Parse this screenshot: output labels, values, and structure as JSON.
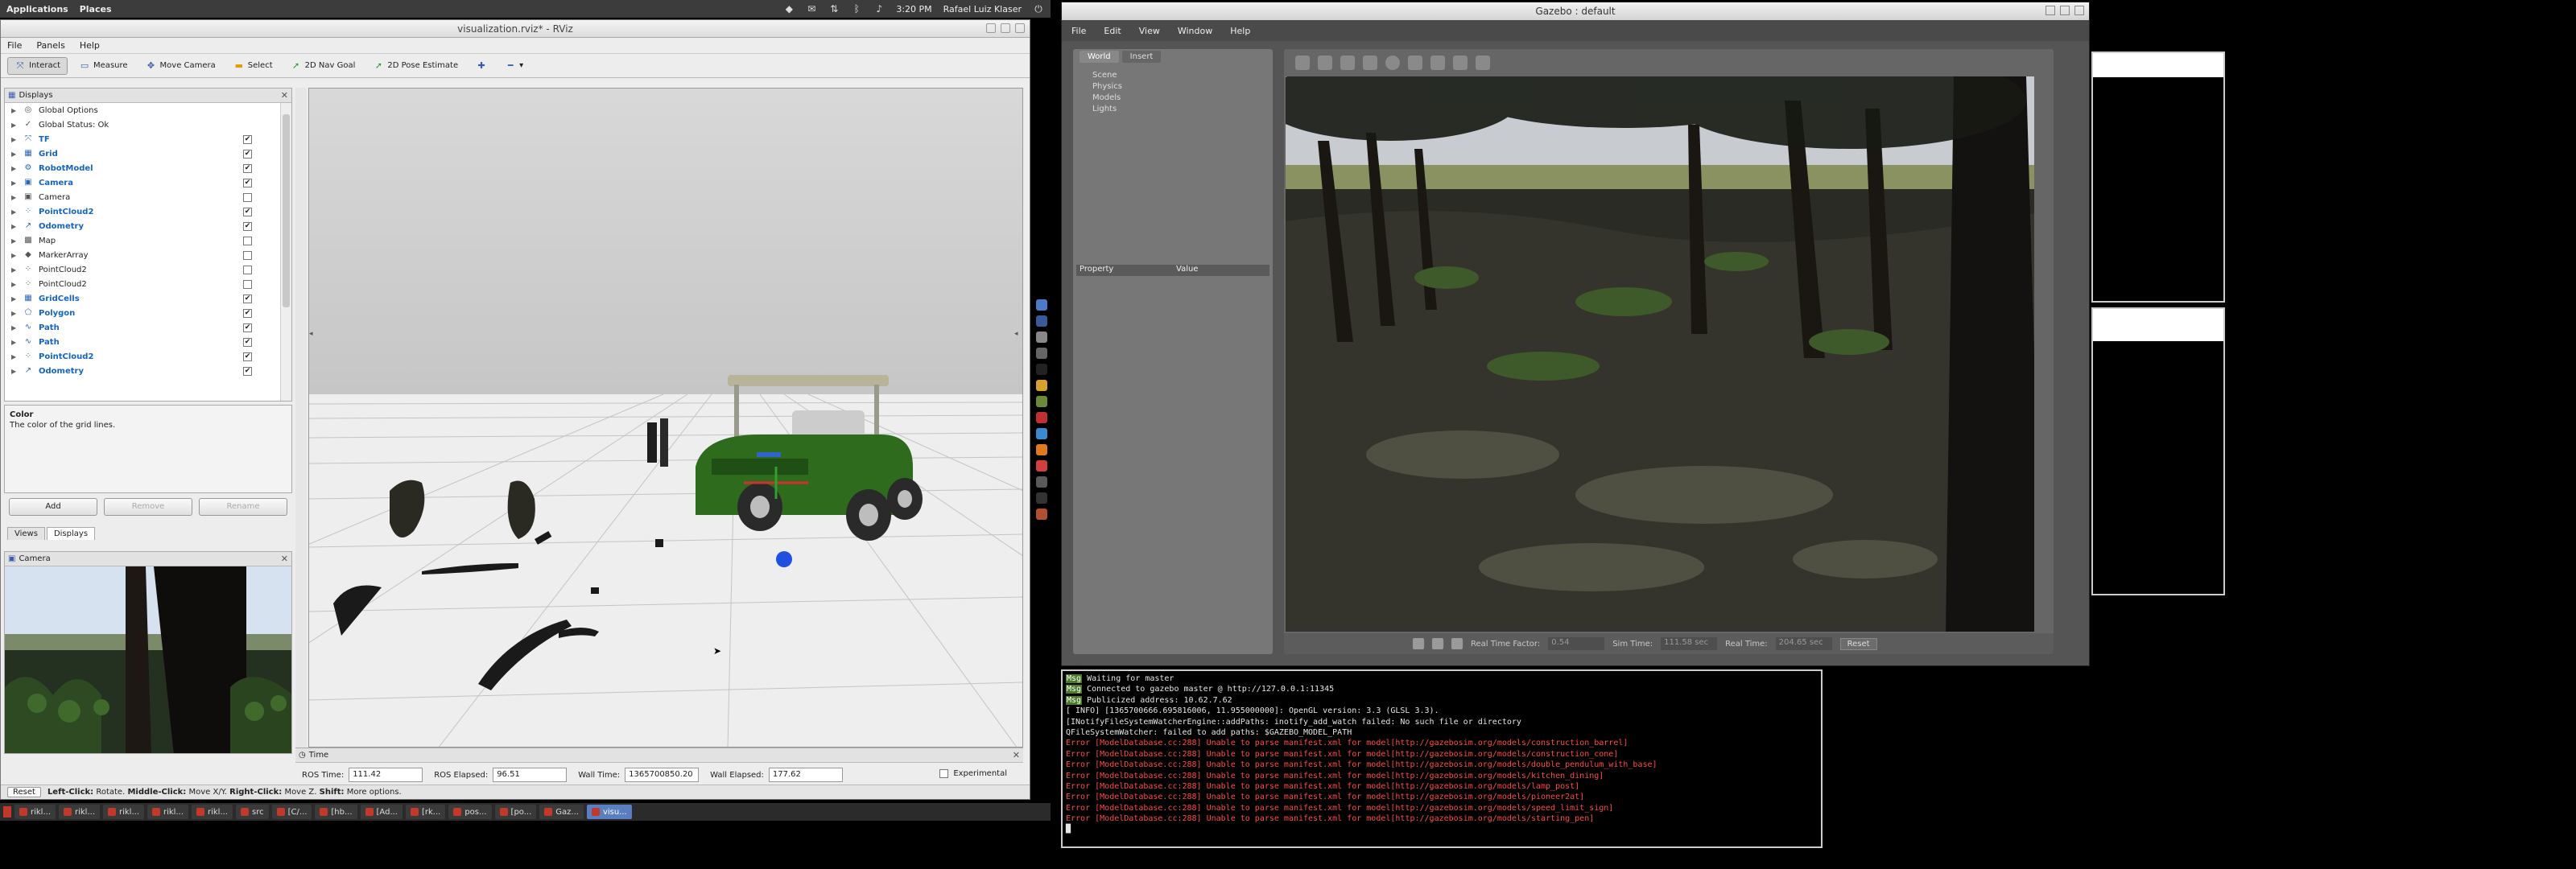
{
  "top_panel": {
    "menu_applications": "Applications",
    "menu_places": "Places",
    "clock": "3:20 PM",
    "user": "Rafael Luiz Klaser"
  },
  "rviz": {
    "title": "visualization.rviz* - RViz",
    "menu": [
      "File",
      "Panels",
      "Help"
    ],
    "toolbar": {
      "interact": "Interact",
      "measure": "Measure",
      "move_camera": "Move Camera",
      "select": "Select",
      "nav_goal": "2D Nav Goal",
      "pose_estimate": "2D Pose Estimate"
    },
    "displays_title": "Displays",
    "displays": [
      {
        "label": "Global Options",
        "blue": false,
        "icon": "globe-icon",
        "checked": null
      },
      {
        "label": "Global Status: Ok",
        "blue": false,
        "icon": "check-icon",
        "checked": null
      },
      {
        "label": "TF",
        "blue": true,
        "icon": "tf-icon",
        "checked": true
      },
      {
        "label": "Grid",
        "blue": true,
        "icon": "grid-icon",
        "checked": true
      },
      {
        "label": "RobotModel",
        "blue": true,
        "icon": "robot-icon",
        "checked": true
      },
      {
        "label": "Camera",
        "blue": true,
        "icon": "camera-icon",
        "checked": true
      },
      {
        "label": "Camera",
        "blue": false,
        "icon": "camera-icon",
        "checked": false
      },
      {
        "label": "PointCloud2",
        "blue": true,
        "icon": "pointcloud-icon",
        "checked": true
      },
      {
        "label": "Odometry",
        "blue": true,
        "icon": "odometry-icon",
        "checked": true
      },
      {
        "label": "Map",
        "blue": false,
        "icon": "map-icon",
        "checked": false
      },
      {
        "label": "MarkerArray",
        "blue": false,
        "icon": "marker-icon",
        "checked": false
      },
      {
        "label": "PointCloud2",
        "blue": false,
        "icon": "pointcloud-icon",
        "checked": false
      },
      {
        "label": "PointCloud2",
        "blue": false,
        "icon": "pointcloud-icon",
        "checked": false
      },
      {
        "label": "GridCells",
        "blue": true,
        "icon": "gridcells-icon",
        "checked": true
      },
      {
        "label": "Polygon",
        "blue": true,
        "icon": "polygon-icon",
        "checked": true
      },
      {
        "label": "Path",
        "blue": true,
        "icon": "path-icon",
        "checked": true
      },
      {
        "label": "Path",
        "blue": true,
        "icon": "path-icon",
        "checked": true
      },
      {
        "label": "PointCloud2",
        "blue": true,
        "icon": "pointcloud-icon",
        "checked": true
      },
      {
        "label": "Odometry",
        "blue": true,
        "icon": "odometry-icon",
        "checked": true
      }
    ],
    "description_title": "Color",
    "description_text": "The color of the grid lines.",
    "buttons": {
      "add": "Add",
      "remove": "Remove",
      "rename": "Rename"
    },
    "tabs": {
      "views": "Views",
      "displays": "Displays"
    },
    "camera_panel_title": "Camera",
    "time_panel": {
      "title": "Time",
      "ros_time_label": "ROS Time:",
      "ros_time": "111.42",
      "ros_elapsed_label": "ROS Elapsed:",
      "ros_elapsed": "96.51",
      "wall_time_label": "Wall Time:",
      "wall_time": "1365700850.20",
      "wall_elapsed_label": "Wall Elapsed:",
      "wall_elapsed": "177.62",
      "experimental": "Experimental"
    },
    "status": {
      "reset": "Reset",
      "left_click": "Left-Click:",
      "left_text": "Rotate.",
      "middle_click": "Middle-Click:",
      "middle_text": "Move X/Y.",
      "right_click": "Right-Click:",
      "right_text": "Move Z.",
      "shift": "Shift:",
      "shift_text": "More options."
    }
  },
  "taskbar": [
    {
      "label": "rikl...",
      "active": false
    },
    {
      "label": "rikl...",
      "active": false
    },
    {
      "label": "rikl...",
      "active": false
    },
    {
      "label": "rikl...",
      "active": false
    },
    {
      "label": "rikl...",
      "active": false
    },
    {
      "label": "src",
      "active": false
    },
    {
      "label": "[C/...",
      "active": false
    },
    {
      "label": "[hb...",
      "active": false
    },
    {
      "label": "[Ad...",
      "active": false
    },
    {
      "label": "[rk...",
      "active": false
    },
    {
      "label": "pos...",
      "active": false
    },
    {
      "label": "[po...",
      "active": false
    },
    {
      "label": "Gaz...",
      "active": false
    },
    {
      "label": "visu...",
      "active": true
    }
  ],
  "gazebo": {
    "title": "Gazebo : default",
    "menu": [
      "File",
      "Edit",
      "View",
      "Window",
      "Help"
    ],
    "tabs": {
      "world": "World",
      "insert": "Insert"
    },
    "tree": [
      "Scene",
      "Physics",
      "Models",
      "Lights"
    ],
    "property_col": "Property",
    "value_col": "Value",
    "bottom": {
      "real_time_factor_label": "Real Time Factor:",
      "real_time_factor": "0.54",
      "sim_time_label": "Sim Time:",
      "sim_time": "111.58 sec",
      "real_time_label": "Real Time:",
      "real_time": "204.65 sec",
      "reset": "Reset"
    }
  },
  "terminal": {
    "lines": [
      {
        "tag": "Msg",
        "text": " Waiting for master",
        "type": "msg"
      },
      {
        "tag": "Msg",
        "text": " Connected to gazebo master @ http://127.0.0.1:11345",
        "type": "msg"
      },
      {
        "tag": "Msg",
        "text": " Publicized address: 10.62.7.62",
        "type": "msg"
      },
      {
        "tag": "",
        "text": "[ INFO] [1365700666.695816006, 11.955000000]: OpenGL version: 3.3 (GLSL 3.3).",
        "type": "plain"
      },
      {
        "tag": "",
        "text": "[INotifyFileSystemWatcherEngine::addPaths: inotify_add_watch failed: No such file or directory",
        "type": "plain"
      },
      {
        "tag": "",
        "text": "QFileSystemWatcher: failed to add paths: $GAZEBO_MODEL_PATH",
        "type": "plain"
      },
      {
        "tag": "Error",
        "text": " [ModelDatabase.cc:288] Unable to parse manifest.xml for model[http://gazebosim.org/models/construction_barrel]",
        "type": "err"
      },
      {
        "tag": "Error",
        "text": " [ModelDatabase.cc:288] Unable to parse manifest.xml for model[http://gazebosim.org/models/construction_cone]",
        "type": "err"
      },
      {
        "tag": "Error",
        "text": " [ModelDatabase.cc:288] Unable to parse manifest.xml for model[http://gazebosim.org/models/double_pendulum_with_base]",
        "type": "err"
      },
      {
        "tag": "Error",
        "text": " [ModelDatabase.cc:288] Unable to parse manifest.xml for model[http://gazebosim.org/models/kitchen_dining]",
        "type": "err"
      },
      {
        "tag": "Error",
        "text": " [ModelDatabase.cc:288] Unable to parse manifest.xml for model[http://gazebosim.org/models/lamp_post]",
        "type": "err"
      },
      {
        "tag": "Error",
        "text": " [ModelDatabase.cc:288] Unable to parse manifest.xml for model[http://gazebosim.org/models/pioneer2at]",
        "type": "err"
      },
      {
        "tag": "Error",
        "text": " [ModelDatabase.cc:288] Unable to parse manifest.xml for model[http://gazebosim.org/models/speed_limit_sign]",
        "type": "err"
      },
      {
        "tag": "Error",
        "text": " [ModelDatabase.cc:288] Unable to parse manifest.xml for model[http://gazebosim.org/models/starting_pen]",
        "type": "err"
      },
      {
        "tag": "",
        "text": "█",
        "type": "plain"
      }
    ]
  },
  "colors": {
    "rviz_blue_label": "#1565c0",
    "terminal_error": "#ff4a4a",
    "terminal_msg_bg": "#4a7a2a",
    "cart_green": "#2f6b1c",
    "grid_floor": "#e8e8e8"
  }
}
